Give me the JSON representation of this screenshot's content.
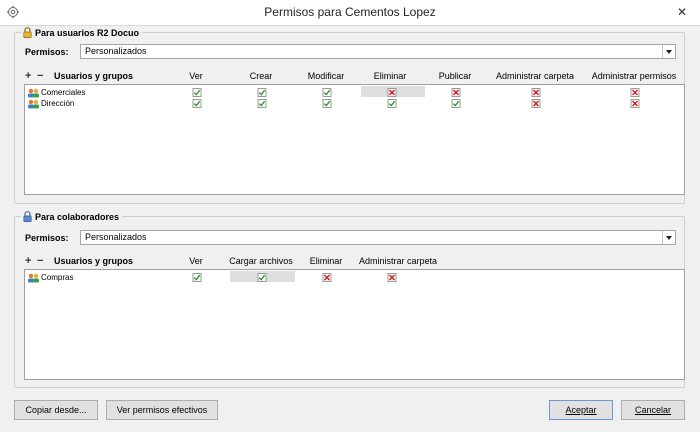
{
  "window": {
    "title": "Permisos para Cementos Lopez"
  },
  "section1": {
    "legend": "Para usuarios R2 Docuo",
    "permisos_label": "Permisos:",
    "permisos_value": "Personalizados",
    "users_header": "Usuarios y grupos",
    "columns": [
      "Ver",
      "Crear",
      "Modificar",
      "Eliminar",
      "Publicar",
      "Administrar carpeta",
      "Administrar permisos"
    ],
    "rows": [
      {
        "name": "Comerciales",
        "values": [
          "yes",
          "yes",
          "yes",
          "no",
          "no",
          "no",
          "no"
        ]
      },
      {
        "name": "Dirección",
        "values": [
          "yes",
          "yes",
          "yes",
          "yes",
          "yes",
          "no",
          "no"
        ]
      }
    ]
  },
  "section2": {
    "legend": "Para colaboradores",
    "permisos_label": "Permisos:",
    "permisos_value": "Personalizados",
    "users_header": "Usuarios y grupos",
    "columns": [
      "Ver",
      "Cargar archivos",
      "Eliminar",
      "Administrar carpeta"
    ],
    "rows": [
      {
        "name": "Compras",
        "values": [
          "yes",
          "yes",
          "no",
          "no"
        ]
      }
    ]
  },
  "buttons": {
    "copy": "Copiar desde...",
    "effective": "Ver permisos efectivos",
    "accept": "Aceptar",
    "cancel": "Cancelar"
  },
  "colors": {
    "check": "#2e9a2e",
    "cross": "#d02020"
  }
}
